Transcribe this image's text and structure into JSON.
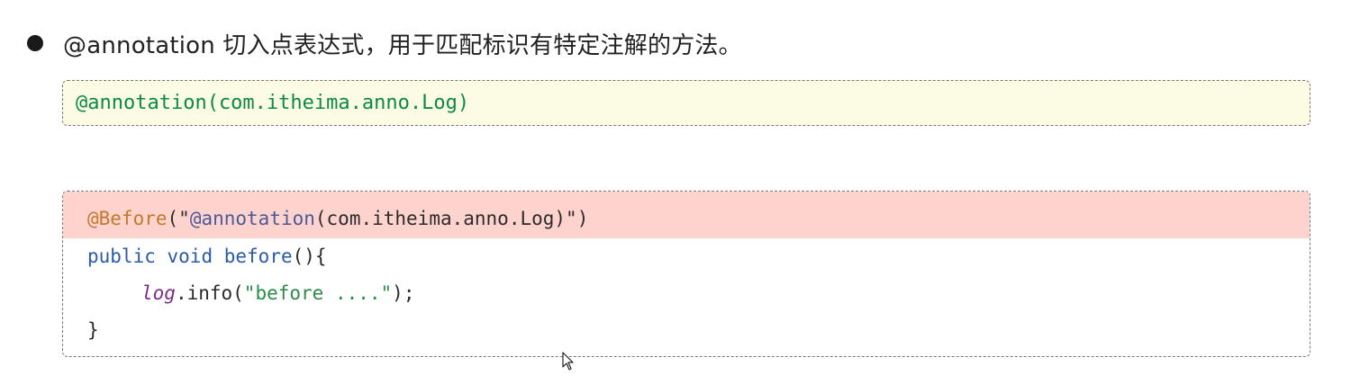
{
  "bullet": {
    "text": "@annotation 切入点表达式，用于匹配标识有特定注解的方法。"
  },
  "tip": {
    "code": "@annotation(com.itheima.anno.Log)"
  },
  "code": {
    "line1": {
      "annotation": "@Before",
      "open": "(\"",
      "arg_annotation": "@annotation",
      "arg_rest": "(com.itheima.anno.Log)",
      "close": "\")"
    },
    "line2": {
      "kw_public": "public",
      "kw_void": "void",
      "method": "before",
      "rest": "(){"
    },
    "line3": {
      "field": "log",
      "call": ".info(",
      "string": "\"before ....\"",
      "end": ");"
    },
    "line4": {
      "brace": "}"
    }
  },
  "colors": {
    "highlight_bg": "#ffd3cd",
    "tip_bg": "#fcfce5",
    "tip_text": "#0b8a43"
  }
}
